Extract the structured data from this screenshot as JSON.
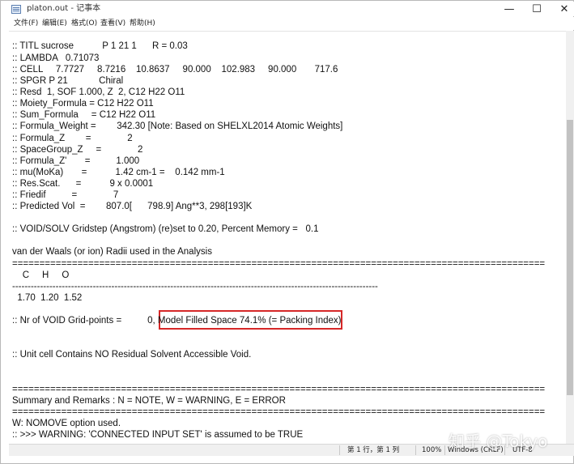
{
  "window": {
    "title": "platon.out - 记事本",
    "min_glyph": "—",
    "max_glyph": "☐",
    "close_glyph": "✕"
  },
  "menu": [
    "文件(F)",
    "编辑(E)",
    "格式(O)",
    "查看(V)",
    "帮助(H)"
  ],
  "lines": [
    ":: TITL sucrose           P 1 21 1      R = 0.03",
    ":: LAMBDA   0.71073",
    ":: CELL     7.7727     8.7216    10.8637     90.000    102.983     90.000       717.6",
    ":: SPGR P 21            Chiral",
    ":: Resd  1, SOF 1.000, Z  2, C12 H22 O11",
    ":: Moiety_Formula = C12 H22 O11",
    ":: Sum_Formula     = C12 H22 O11",
    ":: Formula_Weight =        342.30 [Note: Based on SHELXL2014 Atomic Weights]",
    ":: Formula_Z        =              2",
    ":: SpaceGroup_Z     =              2",
    ":: Formula_Z'       =          1.000",
    ":: mu(MoKa)       =           1.42 cm-1 =    0.142 mm-1",
    ":: Res.Scat.      =           9 x 0.0001",
    ":: Friedif          =              7",
    ":: Predicted Vol  =        807.0[      798.9] Ang**3, 298[193]K",
    "",
    ":: VOID/SOLV Gridstep (Angstrom) (re)set to 0.20, Percent Memory =   0.1",
    "",
    "van der Waals (or ion) Radii used in the Analysis",
    "==================================================================================================",
    "    C     H     O",
    "----------------------------------------------------------------------------------------------------------------------",
    "  1.70  1.20  1.52",
    "",
    ":: Nr of VOID Grid-points =          0, Model Filled Space 74.1% (= Packing Index)",
    "",
    "",
    ":: Unit cell Contains NO Residual Solvent Accessible Void.",
    "",
    "",
    "==================================================================================================",
    "Summary and Remarks : N = NOTE, W = WARNING, E = ERROR",
    "==================================================================================================",
    "W: NOMOVE option used.",
    ":: >>> WARNING: 'CONNECTED INPUT SET' is assumed to be TRUE"
  ],
  "status": {
    "position": "第 1 行，第 1 列",
    "zoom": "100%",
    "line_ending": "Windows (CRLF)",
    "encoding": "UTF-8"
  },
  "watermark": "知乎 @Tokyo",
  "colors": {
    "highlight_border": "#d62828"
  }
}
